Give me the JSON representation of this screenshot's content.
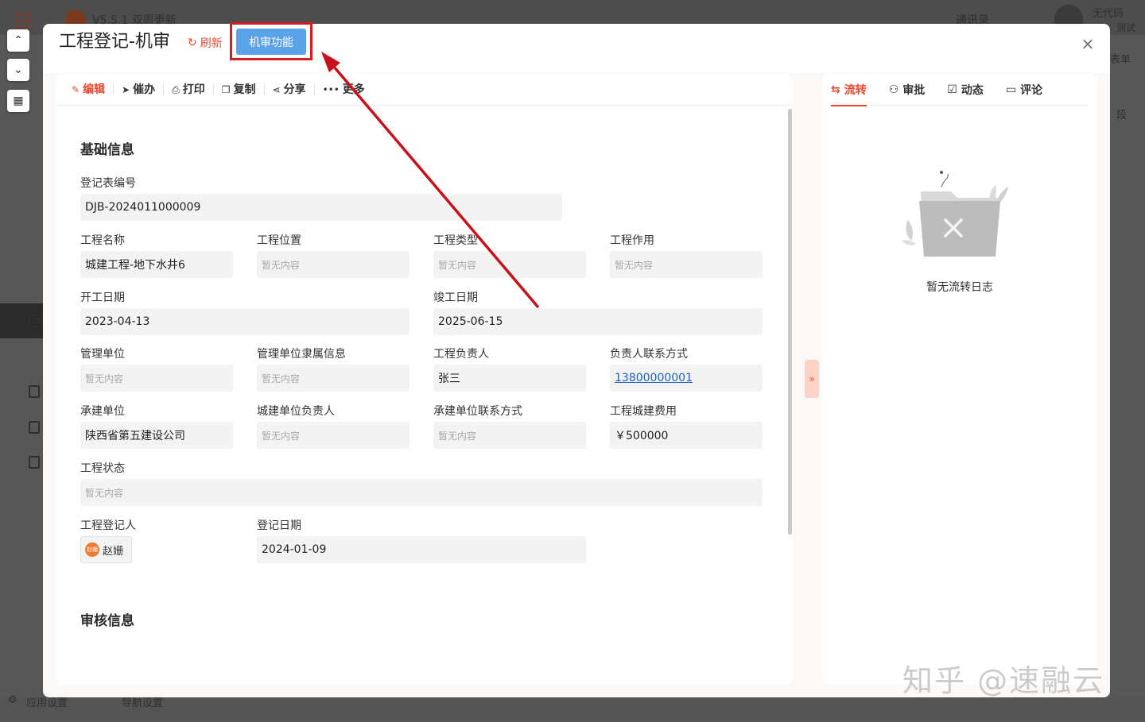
{
  "background": {
    "app_version": "V5.5.1 双周更新",
    "contacts": "通讯录",
    "user_line1": "无代码",
    "user_line2": "测试",
    "right_label1": "表单",
    "right_label2": "段",
    "bottom_item1": "应用设置",
    "bottom_item2": "导航设置"
  },
  "modal": {
    "title": "工程登记-机审",
    "refresh_label": "刷新",
    "audit_button_label": "机审功能",
    "close_glyph": "×"
  },
  "toolbar": {
    "items": [
      {
        "label": "编辑",
        "icon": "✎"
      },
      {
        "label": "催办",
        "icon": "➤"
      },
      {
        "label": "打印",
        "icon": "⎙"
      },
      {
        "label": "复制",
        "icon": "❐"
      },
      {
        "label": "分享",
        "icon": "⋖"
      },
      {
        "label": "更多",
        "icon": "•••"
      }
    ]
  },
  "form": {
    "section_basic": "基础信息",
    "section_review": "审核信息",
    "empty_text": "暂无内容",
    "reg_no_label": "登记表编号",
    "reg_no": "DJB-2024011000009",
    "name_label": "工程名称",
    "name": "城建工程-地下水井6",
    "location_label": "工程位置",
    "type_label": "工程类型",
    "purpose_label": "工程作用",
    "start_label": "开工日期",
    "start": "2023-04-13",
    "end_label": "竣工日期",
    "end": "2025-06-15",
    "mgmt_label": "管理单位",
    "mgmt_info_label": "管理单位隶属信息",
    "leader_label": "工程负责人",
    "leader": "张三",
    "contact_label": "负责人联系方式",
    "contact": "13800000001",
    "builder_label": "承建单位",
    "builder": "陕西省第五建设公司",
    "city_leader_label": "城建单位负责人",
    "builder_contact_label": "承建单位联系方式",
    "cost_label": "工程城建费用",
    "cost": "￥500000",
    "status_label": "工程状态",
    "registrant_label": "工程登记人",
    "registrant": "赵姗",
    "registrant_avatar": "赵姗",
    "reg_date_label": "登记日期",
    "reg_date": "2024-01-09"
  },
  "side": {
    "tabs": [
      {
        "label": "流转",
        "icon": "⇆"
      },
      {
        "label": "审批",
        "icon": "⚇"
      },
      {
        "label": "动态",
        "icon": "☑"
      },
      {
        "label": "评论",
        "icon": "▭"
      }
    ],
    "empty_text": "暂无流转日志"
  },
  "watermark": "知乎 @速融云",
  "colors": {
    "accent": "#e8482c",
    "button_blue": "#5ba3e8",
    "highlight_red": "#d31f24",
    "link_blue": "#1a5fc2"
  }
}
